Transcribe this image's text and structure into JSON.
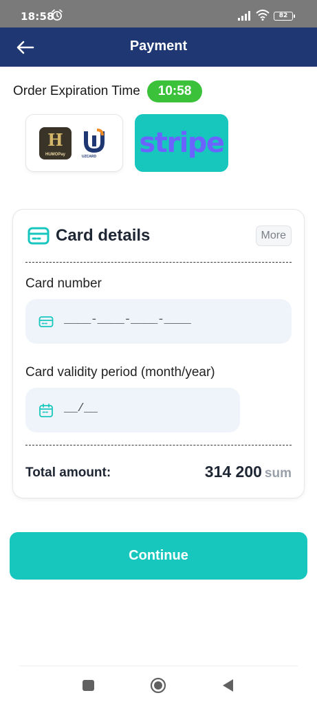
{
  "status_bar": {
    "time": "18:58",
    "battery": "82"
  },
  "app_bar": {
    "title": "Payment",
    "back_icon": "arrow-left-icon"
  },
  "order": {
    "expiration_label": "Order Expiration Time",
    "expiration_time": "10:58"
  },
  "payment_methods": [
    {
      "name": "HUMOPay",
      "logo_letter": "H"
    },
    {
      "name": "UZCARD",
      "logo_letter": "U"
    },
    {
      "name": "stripe"
    }
  ],
  "card_details": {
    "title": "Card details",
    "more_label": "More",
    "card_number_label": "Card number",
    "card_number_placeholder": "____-____-____-____",
    "validity_label": "Card validity period (month/year)",
    "validity_placeholder": "__/__",
    "total_label": "Total amount:",
    "total_value": "314 200",
    "currency": "sum"
  },
  "continue_label": "Continue",
  "colors": {
    "app_bar": "#1f3873",
    "accent": "#17c7be",
    "timer": "#3cc13b",
    "stripe_text": "#6b63ff",
    "input_bg": "#eff4fb"
  }
}
